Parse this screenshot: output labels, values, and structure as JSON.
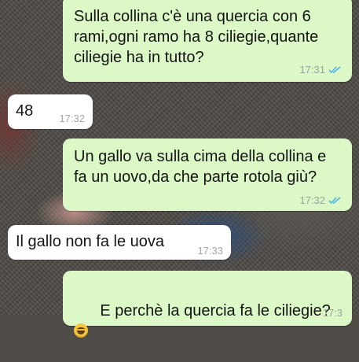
{
  "messages": [
    {
      "direction": "out",
      "text": "Sulla collina c'è una quercia con 6 rami,ogni ramo ha 8 ciliegie,quante ciliegie ha in tutto?",
      "time": "17:31",
      "status": "read"
    },
    {
      "direction": "in",
      "text": "48",
      "time": "17:32"
    },
    {
      "direction": "out",
      "text": "Un gallo va sulla cima della collina e fa un uovo,da che parte rotola giù?",
      "time": "17:32",
      "status": "read"
    },
    {
      "direction": "in",
      "text": "Il gallo non fa le uova",
      "time": "17:33"
    },
    {
      "direction": "out",
      "text": "E perchè la quercia fa le ciliegie?",
      "emoji": "laughing-tears-emoji",
      "time": "17:3",
      "status": "read"
    }
  ],
  "colors": {
    "outgoing_bubble": "#dcf8c6",
    "incoming_bubble": "#ffffff",
    "read_ticks": "#4fb5e8",
    "timestamp": "#9aa29a"
  }
}
